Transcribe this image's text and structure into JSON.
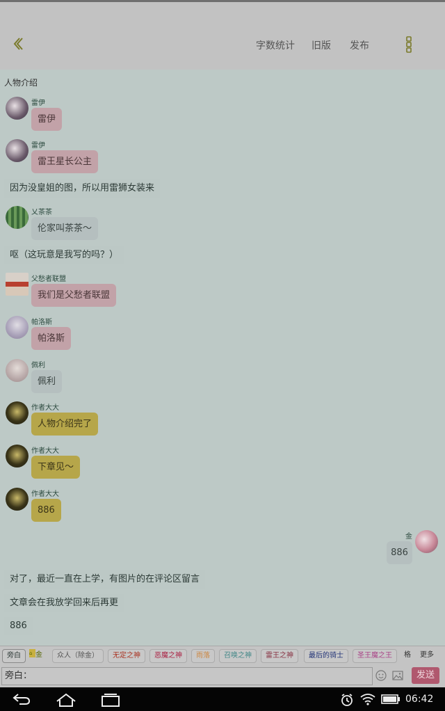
{
  "toolbar": {
    "word_count": "字数统计",
    "old_version": "旧版",
    "publish": "发布"
  },
  "section_title": "人物介绍",
  "messages": [
    {
      "name": "雷伊",
      "text": "雷伊"
    },
    {
      "name": "雷伊",
      "text": "雷王星长公主"
    },
    {
      "name": "乂茶茶",
      "text": "伦家叫茶茶～"
    },
    {
      "name": "父愁者联盟",
      "text": "我们是父愁者联盟"
    },
    {
      "name": "帕洛斯",
      "text": "帕洛斯"
    },
    {
      "name": "佩利",
      "text": "佩利"
    },
    {
      "name": "作者大大",
      "text": "人物介绍完了"
    },
    {
      "name": "作者大大",
      "text": "下章见～"
    },
    {
      "name": "作者大大",
      "text": "886"
    }
  ],
  "narrations": [
    "因为没皇姐的图，所以用雷狮女装来",
    "呕（这玩意是我写的吗？）",
    "对了，最近一直在上学，有图片的在评论区留言",
    "文章会在我放学回来后再更",
    "886"
  ],
  "right_message": {
    "name": "金",
    "text": "886"
  },
  "role_chips": [
    {
      "label": "旁白",
      "color": "#333333"
    },
    {
      "label": "金",
      "color": "#556600"
    },
    {
      "label": "众人（除金）",
      "color": "#555555"
    },
    {
      "label": "无定之神",
      "color": "#aa3322"
    },
    {
      "label": "恶魔之神",
      "color": "#aa2244"
    },
    {
      "label": "雨落",
      "color": "#cc8844"
    },
    {
      "label": "召唤之神",
      "color": "#448888"
    },
    {
      "label": "雷王之神",
      "color": "#883344"
    },
    {
      "label": "最后的骑士",
      "color": "#223377"
    },
    {
      "label": "圣王魔之王",
      "color": "#aa4488"
    },
    {
      "label": "格",
      "color": "#333333"
    }
  ],
  "more_label": "更多",
  "input_value": "旁白：",
  "send_label": "发送",
  "status_time": "06:42"
}
